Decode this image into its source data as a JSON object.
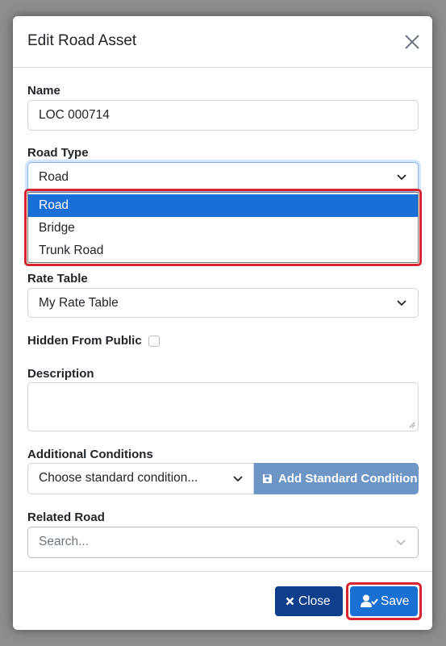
{
  "modal": {
    "title": "Edit Road Asset",
    "close_icon": "close-icon"
  },
  "form": {
    "name": {
      "label": "Name",
      "value": "LOC 000714"
    },
    "road_type": {
      "label": "Road Type",
      "value": "Road",
      "options": [
        "Road",
        "Bridge",
        "Trunk Road"
      ],
      "selected_option": "Road"
    },
    "rate_table": {
      "label": "Rate Table",
      "value": "My Rate Table"
    },
    "hidden_from_public": {
      "label": "Hidden From Public",
      "checked": false
    },
    "description": {
      "label": "Description",
      "value": ""
    },
    "additional_conditions": {
      "label": "Additional Conditions",
      "placeholder": "Choose standard condition...",
      "add_button_label": "Add Standard Condition",
      "add_button_icon": "save-icon"
    },
    "related_road": {
      "label": "Related Road",
      "placeholder": "Search..."
    }
  },
  "footer": {
    "close_label": "Close",
    "close_icon": "x-icon",
    "save_label": "Save",
    "save_icon": "user-check-icon"
  },
  "colors": {
    "primary": "#1a6fd3",
    "close_button": "#0e3e8c",
    "add_button": "#6d96c7",
    "highlight": "#d9232f",
    "selected_option": "#1a6ed8"
  }
}
